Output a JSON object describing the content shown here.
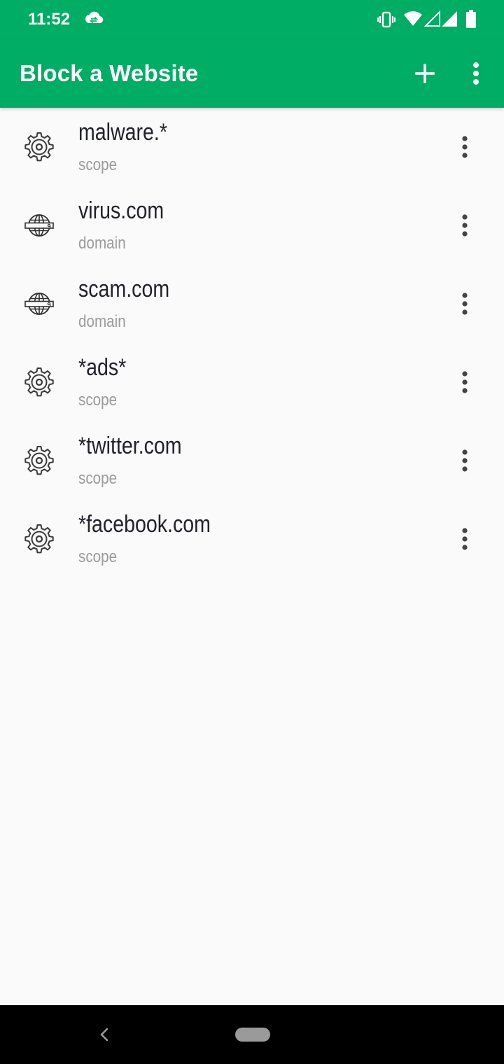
{
  "status_bar": {
    "time": "11:52",
    "icons": [
      "cloud-sync-icon",
      "vibrate-icon",
      "wifi-icon",
      "signal-empty-icon",
      "signal-icon",
      "battery-icon"
    ]
  },
  "app_bar": {
    "title": "Block a Website",
    "actions": [
      "add-icon",
      "more-vert-icon"
    ],
    "color": "#00ad64"
  },
  "items": [
    {
      "name": "malware.*",
      "type": "scope",
      "icon": "gear-icon"
    },
    {
      "name": "virus.com",
      "type": "domain",
      "icon": "globe-icon"
    },
    {
      "name": "scam.com",
      "type": "domain",
      "icon": "globe-icon"
    },
    {
      "name": "*ads*",
      "type": "scope",
      "icon": "gear-icon"
    },
    {
      "name": "*twitter.com",
      "type": "scope",
      "icon": "gear-icon"
    },
    {
      "name": "*facebook.com",
      "type": "scope",
      "icon": "gear-icon"
    }
  ],
  "nav_bar": {
    "icons": [
      "back-icon",
      "home-pill"
    ]
  }
}
